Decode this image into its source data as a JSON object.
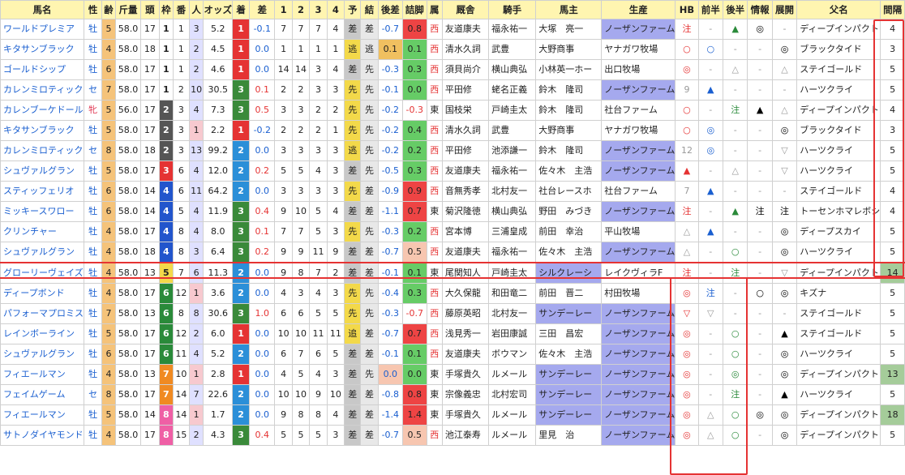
{
  "headers": [
    "馬名",
    "性",
    "齢",
    "斤量",
    "頭",
    "枠",
    "番",
    "人",
    "オッズ",
    "着",
    "差",
    "1",
    "2",
    "3",
    "4",
    "予",
    "結",
    "後差",
    "詰脚",
    "属",
    "厩舎",
    "騎手",
    "馬主",
    "生産",
    "HB",
    "前半",
    "後半",
    "情報",
    "展開",
    "父名",
    "間隔"
  ],
  "waku_colors": {
    "1": "#ffffff",
    "2": "#555555",
    "3": "#e53333",
    "4": "#2255cc",
    "5": "#f3d94a",
    "6": "#2a8a3a",
    "7": "#f08a22",
    "8": "#ef5fa5"
  },
  "chaku_colors": {
    "1": "#e53333",
    "2": "#2b8fd8",
    "3": "#3a8a3a"
  },
  "tsumeashi_colors": {
    "pos": "#ee4444",
    "mid": "#f7c6b0",
    "neg": "#ffffff",
    "green": "#66cc66"
  },
  "rows": [
    {
      "horse": "ワールドプレミア",
      "sex": "牡",
      "age": "5",
      "kin": "58.0",
      "to": "17",
      "waku": "1",
      "ban": "1",
      "nin": "3",
      "odds": "5.2",
      "chaku": "1",
      "sa": "-0.1",
      "c1": "7",
      "c2": "7",
      "c3": "7",
      "c4": "4",
      "yo": "差",
      "ketsu": "差",
      "gosa": "-0.7",
      "tsume": "0.8",
      "zoku": "西",
      "kyusha": "友道康夫",
      "kishu": "福永祐一",
      "banushi": "大塚　亮一",
      "seisan": "ノーザンファーム",
      "hb": "注",
      "zen": "-",
      "kou": "▲",
      "jouhou": "◎",
      "tenkai": "-",
      "chichi": "ディープインパクト",
      "kankaku": "4"
    },
    {
      "horse": "キタサンブラック",
      "sex": "牡",
      "age": "4",
      "kin": "58.0",
      "to": "18",
      "waku": "1",
      "ban": "1",
      "nin": "2",
      "odds": "4.5",
      "chaku": "1",
      "sa": "0.0",
      "c1": "1",
      "c2": "1",
      "c3": "1",
      "c4": "1",
      "yo": "逃",
      "ketsu": "逃",
      "gosa": "0.1",
      "tsume": "0.1",
      "zoku": "西",
      "kyusha": "清水久詞",
      "kishu": "武豊",
      "banushi": "大野商事",
      "seisan": "ヤナガワ牧場",
      "hb": "○",
      "zen": "○",
      "kou": "-",
      "jouhou": "-",
      "tenkai": "◎",
      "chichi": "ブラックタイド",
      "kankaku": "3"
    },
    {
      "horse": "ゴールドシップ",
      "sex": "牡",
      "age": "6",
      "kin": "58.0",
      "to": "17",
      "waku": "1",
      "ban": "1",
      "nin": "2",
      "odds": "4.6",
      "chaku": "1",
      "sa": "0.0",
      "c1": "14",
      "c2": "14",
      "c3": "3",
      "c4": "4",
      "yo": "差",
      "ketsu": "先",
      "gosa": "-0.3",
      "tsume": "0.3",
      "zoku": "西",
      "kyusha": "須貝尚介",
      "kishu": "横山典弘",
      "banushi": "小林英一ホー",
      "seisan": "出口牧場",
      "hb": "◎",
      "zen": "-",
      "kou": "△",
      "jouhou": "-",
      "tenkai": "△",
      "chichi": "ステイゴールド",
      "kankaku": "5"
    },
    {
      "horse": "カレンミロティック",
      "sex": "セ",
      "age": "7",
      "kin": "58.0",
      "to": "17",
      "waku": "1",
      "ban": "2",
      "nin": "10",
      "odds": "30.5",
      "chaku": "3",
      "sa": "0.1",
      "c1": "2",
      "c2": "2",
      "c3": "3",
      "c4": "3",
      "yo": "先",
      "ketsu": "先",
      "gosa": "-0.1",
      "tsume": "0.0",
      "zoku": "西",
      "kyusha": "平田修",
      "kishu": "蛯名正義",
      "banushi": "鈴木　隆司",
      "seisan": "ノーザンファーム",
      "hb": "9",
      "zen": "▲",
      "kou": "-",
      "jouhou": "-",
      "tenkai": "-",
      "chichi": "ハーツクライ",
      "kankaku": "5"
    },
    {
      "horse": "カレンブーケドール",
      "sex": "牝",
      "age": "5",
      "kin": "56.0",
      "to": "17",
      "waku": "2",
      "ban": "3",
      "nin": "4",
      "odds": "7.3",
      "chaku": "3",
      "sa": "0.5",
      "c1": "3",
      "c2": "3",
      "c3": "2",
      "c4": "2",
      "yo": "先",
      "ketsu": "先",
      "gosa": "-0.2",
      "tsume": "-0.3",
      "zoku": "東",
      "kyusha": "国枝栄",
      "kishu": "戸崎圭太",
      "banushi": "鈴木　隆司",
      "seisan": "社台ファーム",
      "hb": "○",
      "zen": "-",
      "kou": "注",
      "jouhou": "▲",
      "tenkai": "△",
      "chichi": "ディープインパクト",
      "kankaku": "4"
    },
    {
      "horse": "キタサンブラック",
      "sex": "牡",
      "age": "5",
      "kin": "58.0",
      "to": "17",
      "waku": "2",
      "ban": "3",
      "nin": "1",
      "odds": "2.2",
      "chaku": "1",
      "sa": "-0.2",
      "c1": "2",
      "c2": "2",
      "c3": "2",
      "c4": "1",
      "yo": "先",
      "ketsu": "先",
      "gosa": "-0.2",
      "tsume": "0.4",
      "zoku": "西",
      "kyusha": "清水久詞",
      "kishu": "武豊",
      "banushi": "大野商事",
      "seisan": "ヤナガワ牧場",
      "hb": "○",
      "zen": "◎",
      "kou": "-",
      "jouhou": "-",
      "tenkai": "◎",
      "chichi": "ブラックタイド",
      "kankaku": "3"
    },
    {
      "horse": "カレンミロティック",
      "sex": "セ",
      "age": "8",
      "kin": "58.0",
      "to": "18",
      "waku": "2",
      "ban": "3",
      "nin": "13",
      "odds": "99.2",
      "chaku": "2",
      "sa": "0.0",
      "c1": "3",
      "c2": "3",
      "c3": "3",
      "c4": "3",
      "yo": "逃",
      "ketsu": "先",
      "gosa": "-0.2",
      "tsume": "0.2",
      "zoku": "西",
      "kyusha": "平田修",
      "kishu": "池添謙一",
      "banushi": "鈴木　隆司",
      "seisan": "ノーザンファーム",
      "hb": "12",
      "zen": "◎",
      "kou": "-",
      "jouhou": "-",
      "tenkai": "▽",
      "chichi": "ハーツクライ",
      "kankaku": "5"
    },
    {
      "horse": "シュヴァルグラン",
      "sex": "牡",
      "age": "5",
      "kin": "58.0",
      "to": "17",
      "waku": "3",
      "ban": "6",
      "nin": "4",
      "odds": "12.0",
      "chaku": "2",
      "sa": "0.2",
      "c1": "5",
      "c2": "5",
      "c3": "4",
      "c4": "3",
      "yo": "差",
      "ketsu": "先",
      "gosa": "-0.5",
      "tsume": "0.3",
      "zoku": "西",
      "kyusha": "友道康夫",
      "kishu": "福永祐一",
      "banushi": "佐々木　主浩",
      "seisan": "ノーザンファーム",
      "hb": "▲",
      "zen": "-",
      "kou": "△",
      "jouhou": "-",
      "tenkai": "▽",
      "chichi": "ハーツクライ",
      "kankaku": "5"
    },
    {
      "horse": "スティッフェリオ",
      "sex": "牡",
      "age": "6",
      "kin": "58.0",
      "to": "14",
      "waku": "4",
      "ban": "6",
      "nin": "11",
      "odds": "64.2",
      "chaku": "2",
      "sa": "0.0",
      "c1": "3",
      "c2": "3",
      "c3": "3",
      "c4": "3",
      "yo": "先",
      "ketsu": "差",
      "gosa": "-0.9",
      "tsume": "0.9",
      "zoku": "西",
      "kyusha": "音無秀孝",
      "kishu": "北村友一",
      "banushi": "社台レースホ",
      "seisan": "社台ファーム",
      "hb": "7",
      "zen": "▲",
      "kou": "-",
      "jouhou": "-",
      "tenkai": "-",
      "chichi": "ステイゴールド",
      "kankaku": "4"
    },
    {
      "horse": "ミッキースワロー",
      "sex": "牡",
      "age": "6",
      "kin": "58.0",
      "to": "14",
      "waku": "4",
      "ban": "5",
      "nin": "4",
      "odds": "11.9",
      "chaku": "3",
      "sa": "0.4",
      "c1": "9",
      "c2": "10",
      "c3": "5",
      "c4": "4",
      "yo": "差",
      "ketsu": "差",
      "gosa": "-1.1",
      "tsume": "0.7",
      "zoku": "東",
      "kyusha": "菊沢隆徳",
      "kishu": "横山典弘",
      "banushi": "野田　みづき",
      "seisan": "ノーザンファーム",
      "hb": "注",
      "zen": "-",
      "kou": "▲",
      "jouhou": "注",
      "tenkai": "注",
      "chichi": "トーセンホマレボシ",
      "kankaku": "4"
    },
    {
      "horse": "クリンチャー",
      "sex": "牡",
      "age": "4",
      "kin": "58.0",
      "to": "17",
      "waku": "4",
      "ban": "8",
      "nin": "4",
      "odds": "8.0",
      "chaku": "3",
      "sa": "0.1",
      "c1": "7",
      "c2": "7",
      "c3": "5",
      "c4": "3",
      "yo": "先",
      "ketsu": "先",
      "gosa": "-0.3",
      "tsume": "0.2",
      "zoku": "西",
      "kyusha": "宮本博",
      "kishu": "三浦皇成",
      "banushi": "前田　幸治",
      "seisan": "平山牧場",
      "hb": "△",
      "zen": "▲",
      "kou": "-",
      "jouhou": "-",
      "tenkai": "◎",
      "chichi": "ディープスカイ",
      "kankaku": "5"
    },
    {
      "horse": "シュヴァルグラン",
      "sex": "牡",
      "age": "4",
      "kin": "58.0",
      "to": "18",
      "waku": "4",
      "ban": "8",
      "nin": "3",
      "odds": "6.4",
      "chaku": "3",
      "sa": "0.2",
      "c1": "9",
      "c2": "9",
      "c3": "11",
      "c4": "9",
      "yo": "差",
      "ketsu": "差",
      "gosa": "-0.7",
      "tsume": "0.5",
      "zoku": "西",
      "kyusha": "友道康夫",
      "kishu": "福永祐一",
      "banushi": "佐々木　主浩",
      "seisan": "ノーザンファーム",
      "hb": "△",
      "zen": "-",
      "kou": "○",
      "jouhou": "-",
      "tenkai": "◎",
      "chichi": "ハーツクライ",
      "kankaku": "5"
    },
    {
      "horse": "グローリーヴェイズ",
      "sex": "牡",
      "age": "4",
      "kin": "58.0",
      "to": "13",
      "waku": "5",
      "ban": "7",
      "nin": "6",
      "odds": "11.3",
      "chaku": "2",
      "sa": "0.0",
      "c1": "9",
      "c2": "8",
      "c3": "7",
      "c4": "2",
      "yo": "差",
      "ketsu": "差",
      "gosa": "-0.1",
      "tsume": "0.1",
      "zoku": "東",
      "kyusha": "尾関知人",
      "kishu": "戸崎圭太",
      "banushi": "シルクレーシ",
      "seisan": "レイクヴィラF",
      "hb": "注",
      "zen": "-",
      "kou": "注",
      "jouhou": "-",
      "tenkai": "▽",
      "chichi": "ディープインパクト",
      "kankaku": "14"
    },
    {
      "horse": "ディープボンド",
      "sex": "牡",
      "age": "4",
      "kin": "58.0",
      "to": "17",
      "waku": "6",
      "ban": "12",
      "nin": "1",
      "odds": "3.6",
      "chaku": "2",
      "sa": "0.0",
      "c1": "4",
      "c2": "3",
      "c3": "4",
      "c4": "3",
      "yo": "先",
      "ketsu": "先",
      "gosa": "-0.4",
      "tsume": "0.3",
      "zoku": "西",
      "kyusha": "大久保龍",
      "kishu": "和田竜二",
      "banushi": "前田　晋二",
      "seisan": "村田牧場",
      "hb": "◎",
      "zen": "注",
      "kou": "-",
      "jouhou": "○",
      "tenkai": "◎",
      "chichi": "キズナ",
      "kankaku": "5"
    },
    {
      "horse": "パフォーマプロミス",
      "sex": "牡",
      "age": "7",
      "kin": "58.0",
      "to": "13",
      "waku": "6",
      "ban": "8",
      "nin": "8",
      "odds": "30.6",
      "chaku": "3",
      "sa": "1.0",
      "c1": "6",
      "c2": "6",
      "c3": "5",
      "c4": "5",
      "yo": "先",
      "ketsu": "先",
      "gosa": "-0.3",
      "tsume": "-0.7",
      "zoku": "西",
      "kyusha": "藤原英昭",
      "kishu": "北村友一",
      "banushi": "サンデーレー",
      "seisan": "ノーザンファーム",
      "hb": "▽",
      "zen": "▽",
      "kou": "-",
      "jouhou": "-",
      "tenkai": "-",
      "chichi": "ステイゴールド",
      "kankaku": "5"
    },
    {
      "horse": "レインボーライン",
      "sex": "牡",
      "age": "5",
      "kin": "58.0",
      "to": "17",
      "waku": "6",
      "ban": "12",
      "nin": "2",
      "odds": "6.0",
      "chaku": "1",
      "sa": "0.0",
      "c1": "10",
      "c2": "10",
      "c3": "11",
      "c4": "11",
      "yo": "追",
      "ketsu": "差",
      "gosa": "-0.7",
      "tsume": "0.7",
      "zoku": "西",
      "kyusha": "浅見秀一",
      "kishu": "岩田康誠",
      "banushi": "三田　昌宏",
      "seisan": "ノーザンファーム",
      "hb": "◎",
      "zen": "-",
      "kou": "○",
      "jouhou": "-",
      "tenkai": "▲",
      "chichi": "ステイゴールド",
      "kankaku": "5"
    },
    {
      "horse": "シュヴァルグラン",
      "sex": "牡",
      "age": "6",
      "kin": "58.0",
      "to": "17",
      "waku": "6",
      "ban": "11",
      "nin": "4",
      "odds": "5.2",
      "chaku": "2",
      "sa": "0.0",
      "c1": "6",
      "c2": "7",
      "c3": "6",
      "c4": "5",
      "yo": "差",
      "ketsu": "差",
      "gosa": "-0.1",
      "tsume": "0.1",
      "zoku": "西",
      "kyusha": "友道康夫",
      "kishu": "ボウマン",
      "banushi": "佐々木　主浩",
      "seisan": "ノーザンファーム",
      "hb": "◎",
      "zen": "-",
      "kou": "○",
      "jouhou": "-",
      "tenkai": "◎",
      "chichi": "ハーツクライ",
      "kankaku": "5"
    },
    {
      "horse": "フィエールマン",
      "sex": "牡",
      "age": "4",
      "kin": "58.0",
      "to": "13",
      "waku": "7",
      "ban": "10",
      "nin": "1",
      "odds": "2.8",
      "chaku": "1",
      "sa": "0.0",
      "c1": "4",
      "c2": "5",
      "c3": "4",
      "c4": "3",
      "yo": "差",
      "ketsu": "先",
      "gosa": "0.0",
      "tsume": "0.0",
      "zoku": "東",
      "kyusha": "手塚貴久",
      "kishu": "ルメール",
      "banushi": "サンデーレー",
      "seisan": "ノーザンファーム",
      "hb": "◎",
      "zen": "-",
      "kou": "◎",
      "jouhou": "-",
      "tenkai": "◎",
      "chichi": "ディープインパクト",
      "kankaku": "13"
    },
    {
      "horse": "フェイムゲーム",
      "sex": "セ",
      "age": "8",
      "kin": "58.0",
      "to": "17",
      "waku": "7",
      "ban": "14",
      "nin": "7",
      "odds": "22.6",
      "chaku": "2",
      "sa": "0.0",
      "c1": "10",
      "c2": "10",
      "c3": "9",
      "c4": "10",
      "yo": "差",
      "ketsu": "差",
      "gosa": "-0.8",
      "tsume": "0.8",
      "zoku": "東",
      "kyusha": "宗像義忠",
      "kishu": "北村宏司",
      "banushi": "サンデーレー",
      "seisan": "ノーザンファーム",
      "hb": "◎",
      "zen": "-",
      "kou": "注",
      "jouhou": "-",
      "tenkai": "▲",
      "chichi": "ハーツクライ",
      "kankaku": "5"
    },
    {
      "horse": "フィエールマン",
      "sex": "牡",
      "age": "5",
      "kin": "58.0",
      "to": "14",
      "waku": "8",
      "ban": "14",
      "nin": "1",
      "odds": "1.7",
      "chaku": "2",
      "sa": "0.0",
      "c1": "9",
      "c2": "8",
      "c3": "8",
      "c4": "4",
      "yo": "差",
      "ketsu": "差",
      "gosa": "-1.4",
      "tsume": "1.4",
      "zoku": "東",
      "kyusha": "手塚貴久",
      "kishu": "ルメール",
      "banushi": "サンデーレー",
      "seisan": "ノーザンファーム",
      "hb": "◎",
      "zen": "△",
      "kou": "○",
      "jouhou": "◎",
      "tenkai": "◎",
      "chichi": "ディープインパクト",
      "kankaku": "18"
    },
    {
      "horse": "サトノダイヤモンド",
      "sex": "牡",
      "age": "4",
      "kin": "58.0",
      "to": "17",
      "waku": "8",
      "ban": "15",
      "nin": "2",
      "odds": "4.3",
      "chaku": "3",
      "sa": "0.4",
      "c1": "5",
      "c2": "5",
      "c3": "5",
      "c4": "3",
      "yo": "差",
      "ketsu": "差",
      "gosa": "-0.7",
      "tsume": "0.5",
      "zoku": "西",
      "kyusha": "池江泰寿",
      "kishu": "ルメール",
      "banushi": "里見　治",
      "seisan": "ノーザンファーム",
      "hb": "◎",
      "zen": "△",
      "kou": "○",
      "jouhou": "-",
      "tenkai": "◎",
      "chichi": "ディープインパクト",
      "kankaku": "5"
    }
  ]
}
